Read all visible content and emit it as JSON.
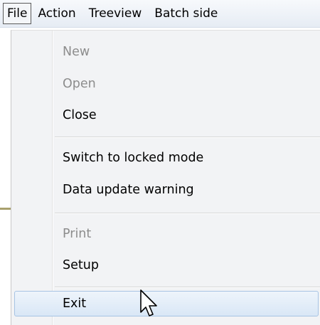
{
  "menubar": {
    "items": [
      {
        "label": "File",
        "active": true
      },
      {
        "label": "Action"
      },
      {
        "label": "Treeview"
      },
      {
        "label": "Batch side"
      }
    ]
  },
  "file_menu": {
    "groups": [
      [
        {
          "label": "New",
          "enabled": false
        },
        {
          "label": "Open",
          "enabled": false
        },
        {
          "label": "Close",
          "enabled": true
        }
      ],
      [
        {
          "label": "Switch to locked mode",
          "enabled": true
        },
        {
          "label": "Data update warning",
          "enabled": true
        }
      ],
      [
        {
          "label": "Print",
          "enabled": false
        },
        {
          "label": "Setup",
          "enabled": true
        }
      ],
      [
        {
          "label": "Exit",
          "enabled": true,
          "hovered": true
        }
      ]
    ]
  },
  "colors": {
    "highlight_border": "#a7c4e4",
    "disabled_text": "#8d8d8d",
    "accent_line": "#a9a06d"
  },
  "icons": {
    "cursor": "mouse-pointer-arrow-icon"
  }
}
